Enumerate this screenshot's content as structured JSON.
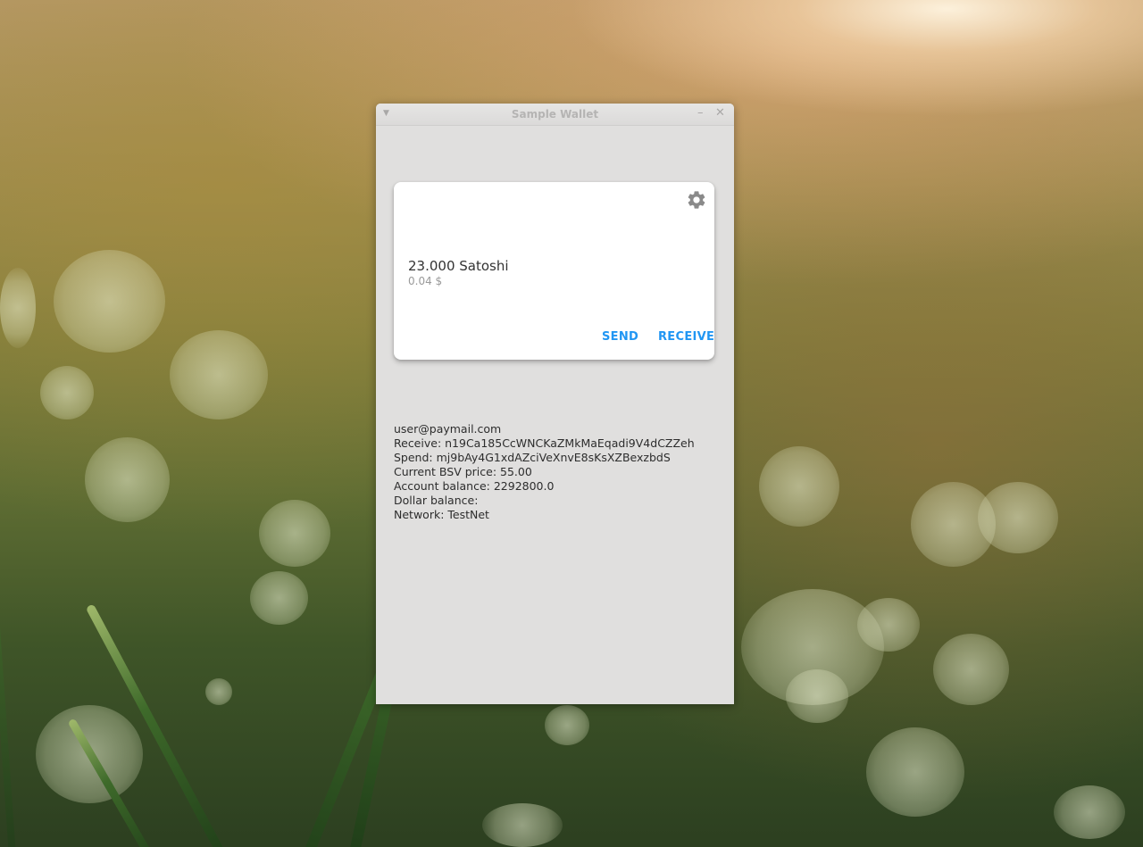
{
  "window": {
    "title": "Sample Wallet"
  },
  "card": {
    "balance": "23.000 Satoshi",
    "usd": "0.04 $",
    "send_label": "SEND",
    "receive_label": "RECEIVE",
    "settings_icon": "gear-icon"
  },
  "info": {
    "paymail": "user@paymail.com",
    "receive": "Receive: n19Ca185CcWNCKaZMkMaEqadi9V4dCZZeh",
    "spend": "Spend: mj9bAy4G1xdAZciVeXnvE8sKsXZBexzbdS",
    "price": "Current BSV price: 55.00",
    "account_balance": "Account balance: 2292800.0",
    "dollar_balance": "Dollar balance:",
    "network": "Network: TestNet"
  },
  "colors": {
    "accent": "#2196f3",
    "window_bg": "#e0dfde",
    "card_bg": "#ffffff"
  }
}
